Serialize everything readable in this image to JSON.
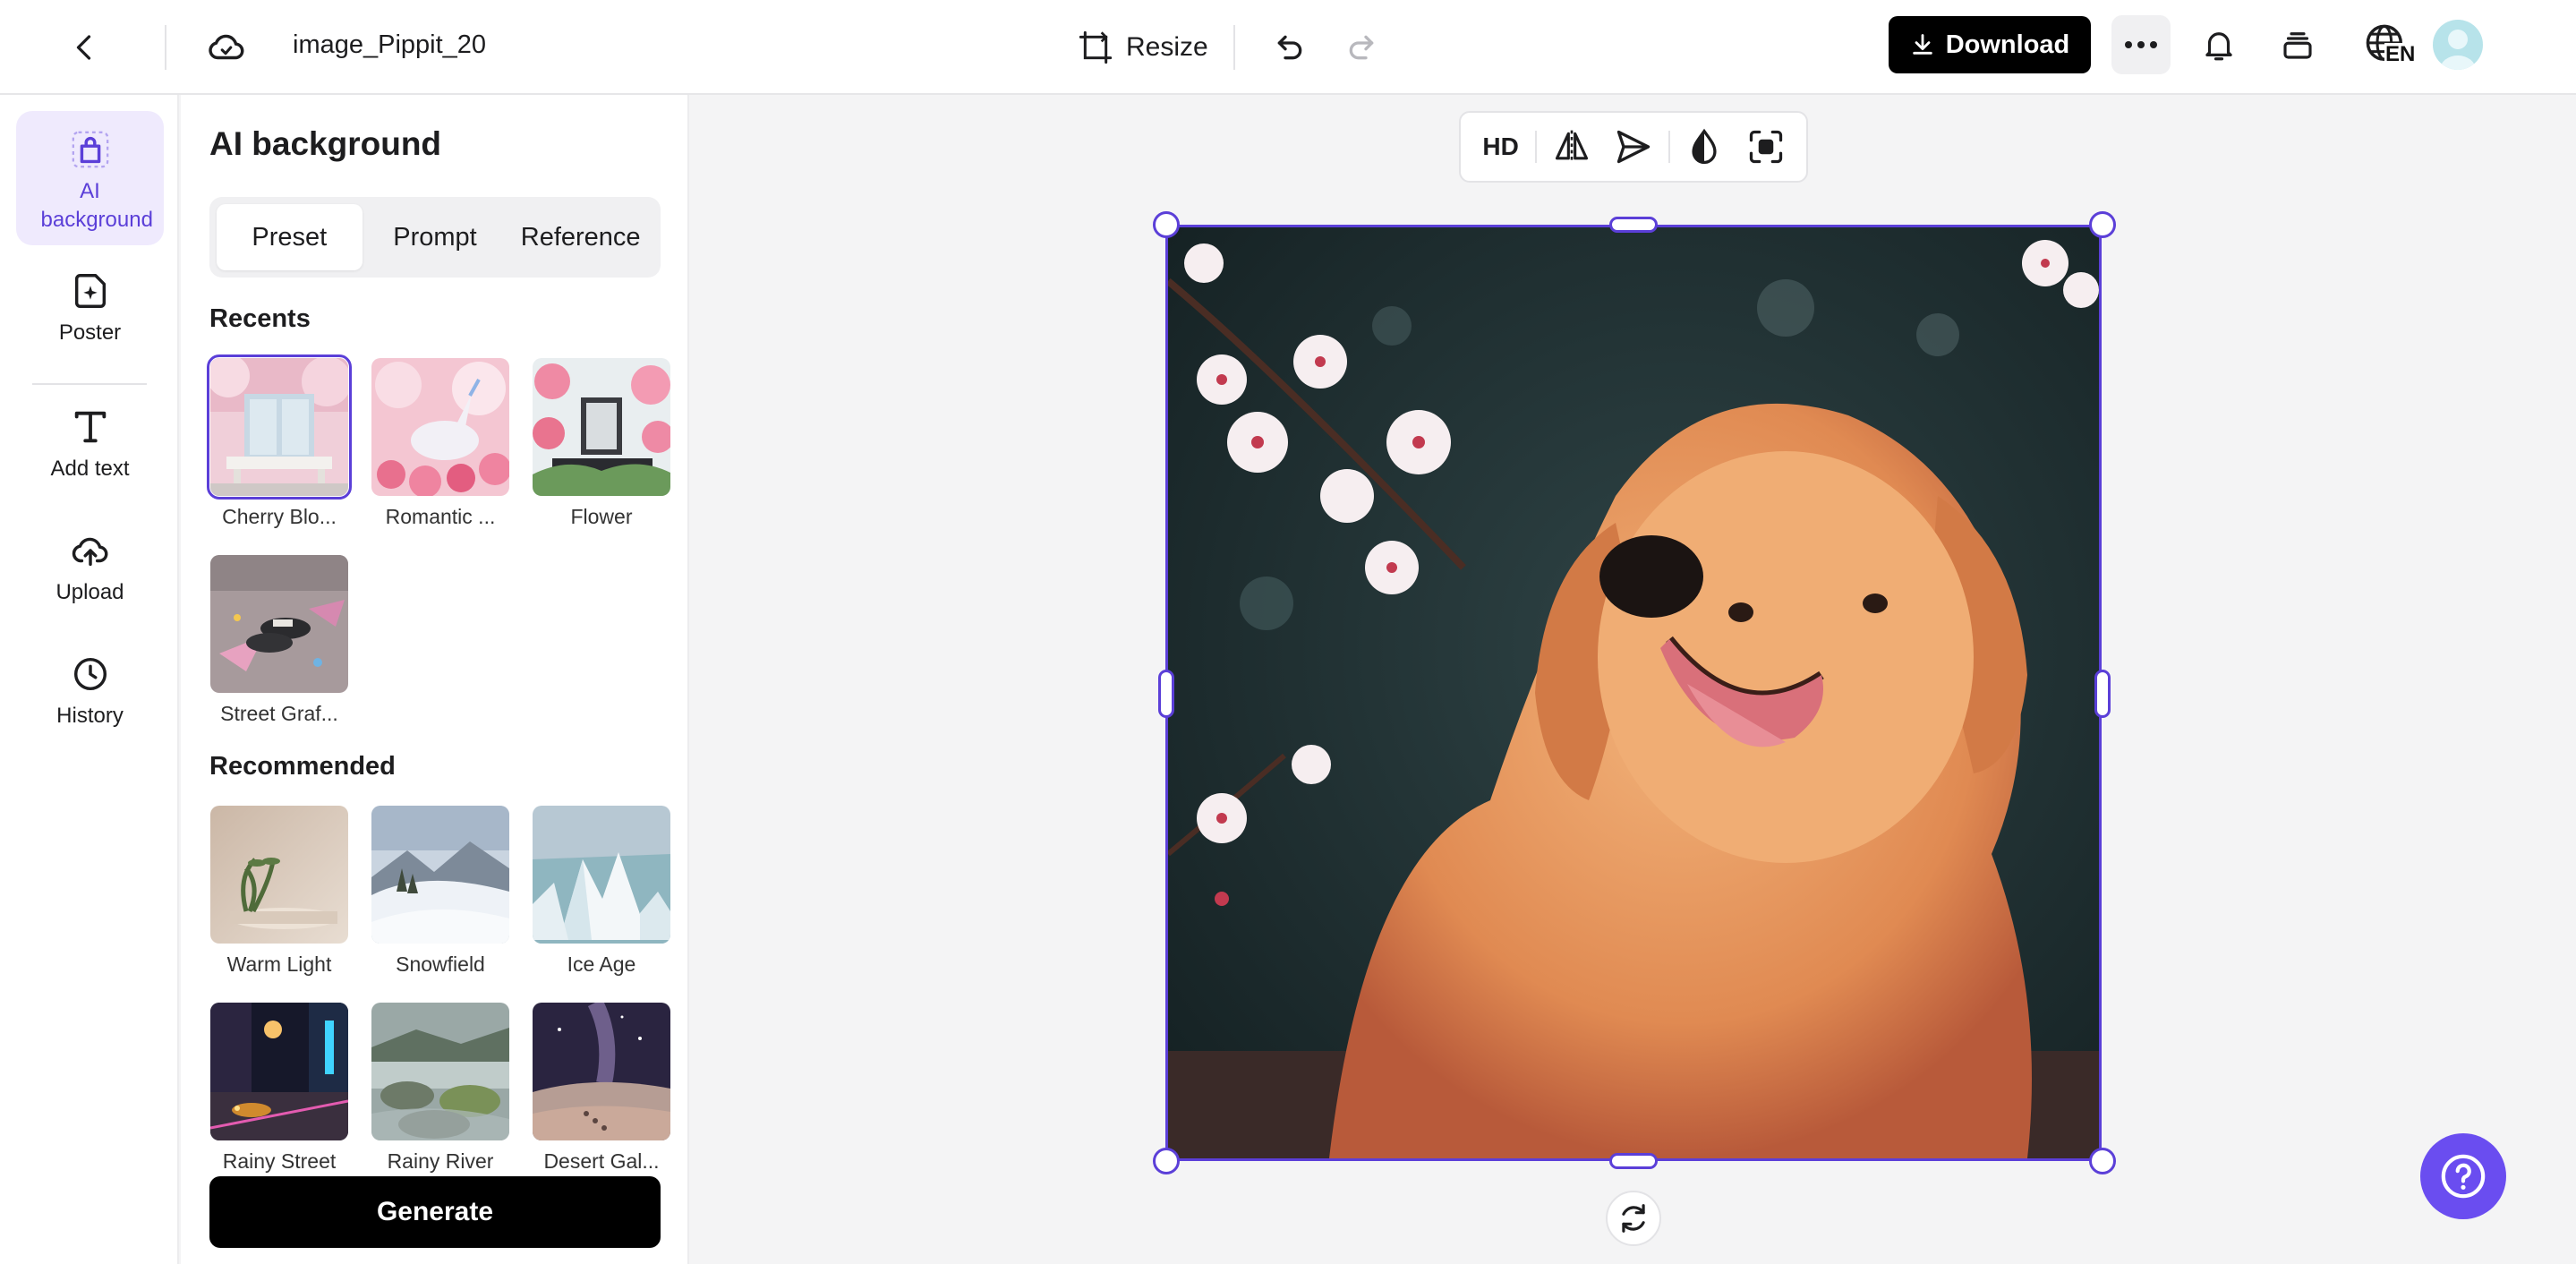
{
  "header": {
    "doc_title": "image_Pippit_20",
    "resize_label": "Resize",
    "download_label": "Download",
    "lang_code": "EN"
  },
  "rail": {
    "items": [
      {
        "label": "AI background"
      },
      {
        "label": "Poster"
      },
      {
        "label": "Add text"
      },
      {
        "label": "Upload"
      },
      {
        "label": "History"
      }
    ]
  },
  "panel": {
    "title": "AI background",
    "tabs": [
      {
        "label": "Preset"
      },
      {
        "label": "Prompt"
      },
      {
        "label": "Reference"
      }
    ],
    "recents_title": "Recents",
    "recents": [
      {
        "label": "Cherry Blo..."
      },
      {
        "label": "Romantic ..."
      },
      {
        "label": "Flower"
      },
      {
        "label": "Street Graf..."
      }
    ],
    "recommended_title": "Recommended",
    "recommended": [
      {
        "label": "Warm Light"
      },
      {
        "label": "Snowfield"
      },
      {
        "label": "Ice Age"
      },
      {
        "label": "Rainy Street"
      },
      {
        "label": "Rainy River"
      },
      {
        "label": "Desert Gal..."
      }
    ],
    "generate_label": "Generate"
  },
  "toolbar": {
    "hd_label": "HD"
  },
  "colors": {
    "accent": "#5b3fd8",
    "help": "#6a4df0"
  }
}
